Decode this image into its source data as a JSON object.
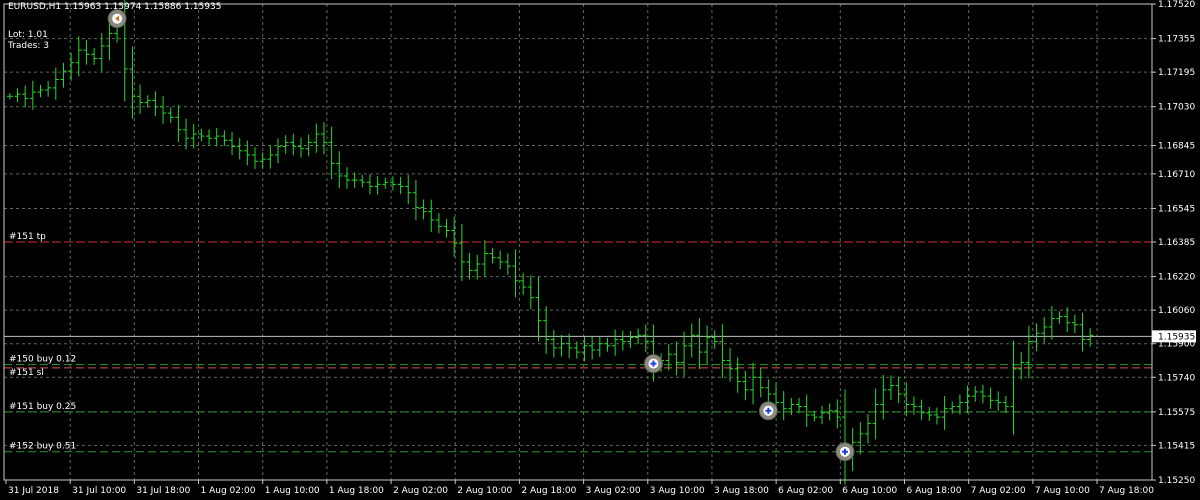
{
  "header": {
    "title": "EURUSD,H1",
    "ohlc": "1.15963 1.15974 1.15886 1.15935",
    "lot": "Lot: 1.01",
    "trades": "Trades: 3"
  },
  "colors": {
    "background": "#000000",
    "grid": "#5a6a5a",
    "candle": "#22dd22",
    "tp_line": "#e03030",
    "sl_line": "#e05050",
    "buy_line": "#2a9a2a",
    "bid_line": "#c0c0c0",
    "text": "#ffffff"
  },
  "chart_data": {
    "type": "ohlc",
    "symbol": "EURUSD",
    "timeframe": "H1",
    "ylim": [
      1.1525,
      1.1752
    ],
    "price_ticks": [
      "1.17520",
      "1.17355",
      "1.17195",
      "1.17030",
      "1.16845",
      "1.16710",
      "1.16545",
      "1.16385",
      "1.16220",
      "1.16060",
      "1.15900",
      "1.15740",
      "1.15575",
      "1.15415",
      "1.15250"
    ],
    "time_ticks": [
      "31 Jul 2018",
      "31 Jul 10:00",
      "31 Jul 18:00",
      "1 Aug 02:00",
      "1 Aug 10:00",
      "1 Aug 18:00",
      "2 Aug 02:00",
      "2 Aug 10:00",
      "2 Aug 18:00",
      "3 Aug 02:00",
      "3 Aug 10:00",
      "3 Aug 18:00",
      "6 Aug 02:00",
      "6 Aug 10:00",
      "6 Aug 18:00",
      "7 Aug 02:00",
      "7 Aug 10:00",
      "7 Aug 18:00"
    ],
    "current_price": "1.15935",
    "order_lines": [
      {
        "label": "#151 tp",
        "price": 1.16385,
        "kind": "tp"
      },
      {
        "label": "#150 buy 0.12",
        "price": 1.158,
        "kind": "buy"
      },
      {
        "label": "#151 sl",
        "price": 1.15785,
        "kind": "sl"
      },
      {
        "label": "#151 buy 0.25",
        "price": 1.15575,
        "kind": "buy"
      },
      {
        "label": "#152 buy 0.51",
        "price": 1.15385,
        "kind": "buy"
      }
    ],
    "trade_markers": [
      {
        "bar": 14,
        "price": 1.1745,
        "kind": "close"
      },
      {
        "bar": 84,
        "price": 1.15805,
        "kind": "open"
      },
      {
        "bar": 99,
        "price": 1.1558,
        "kind": "open"
      },
      {
        "bar": 109,
        "price": 1.15385,
        "kind": "open"
      }
    ],
    "bar_start_index": 0,
    "bars_close": [
      1.1708,
      1.1709,
      1.1707,
      1.171,
      1.1711,
      1.1712,
      1.1716,
      1.172,
      1.1724,
      1.173,
      1.1728,
      1.1726,
      1.1732,
      1.1738,
      1.1743,
      1.1721,
      1.1708,
      1.1705,
      1.1706,
      1.1703,
      1.17,
      1.1698,
      1.1692,
      1.1688,
      1.169,
      1.1689,
      1.1688,
      1.1689,
      1.1687,
      1.1684,
      1.1682,
      1.168,
      1.1677,
      1.1678,
      1.168,
      1.1684,
      1.1686,
      1.1684,
      1.1683,
      1.1686,
      1.169,
      1.1686,
      1.1676,
      1.167,
      1.1668,
      1.1668,
      1.1667,
      1.1665,
      1.1666,
      1.1667,
      1.1666,
      1.1665,
      1.1662,
      1.1655,
      1.1653,
      1.1649,
      1.1646,
      1.1644,
      1.1638,
      1.1629,
      1.1625,
      1.1628,
      1.1633,
      1.1631,
      1.1629,
      1.1627,
      1.162,
      1.1617,
      1.1612,
      1.1601,
      1.1592,
      1.1588,
      1.159,
      1.1588,
      1.1586,
      1.1589,
      1.1587,
      1.159,
      1.1589,
      1.1592,
      1.1591,
      1.1593,
      1.1594,
      1.1591,
      1.158,
      1.1582,
      1.1585,
      1.1581,
      1.1589,
      1.1594,
      1.1586,
      1.1593,
      1.1591,
      1.1582,
      1.1578,
      1.1572,
      1.1568,
      1.1574,
      1.1569,
      1.1566,
      1.1562,
      1.1559,
      1.1561,
      1.156,
      1.1556,
      1.1555,
      1.1557,
      1.1558,
      1.1555,
      1.1536,
      1.1543,
      1.1547,
      1.1552,
      1.1561,
      1.1568,
      1.157,
      1.1566,
      1.1561,
      1.156,
      1.1557,
      1.1556,
      1.1555,
      1.1559,
      1.156,
      1.1562,
      1.1565,
      1.1567,
      1.1565,
      1.1563,
      1.1562,
      1.156,
      1.1578,
      1.1581,
      1.1591,
      1.1595,
      1.1598,
      1.1602,
      1.1603,
      1.16,
      1.1599,
      1.1592,
      1.1594
    ]
  }
}
